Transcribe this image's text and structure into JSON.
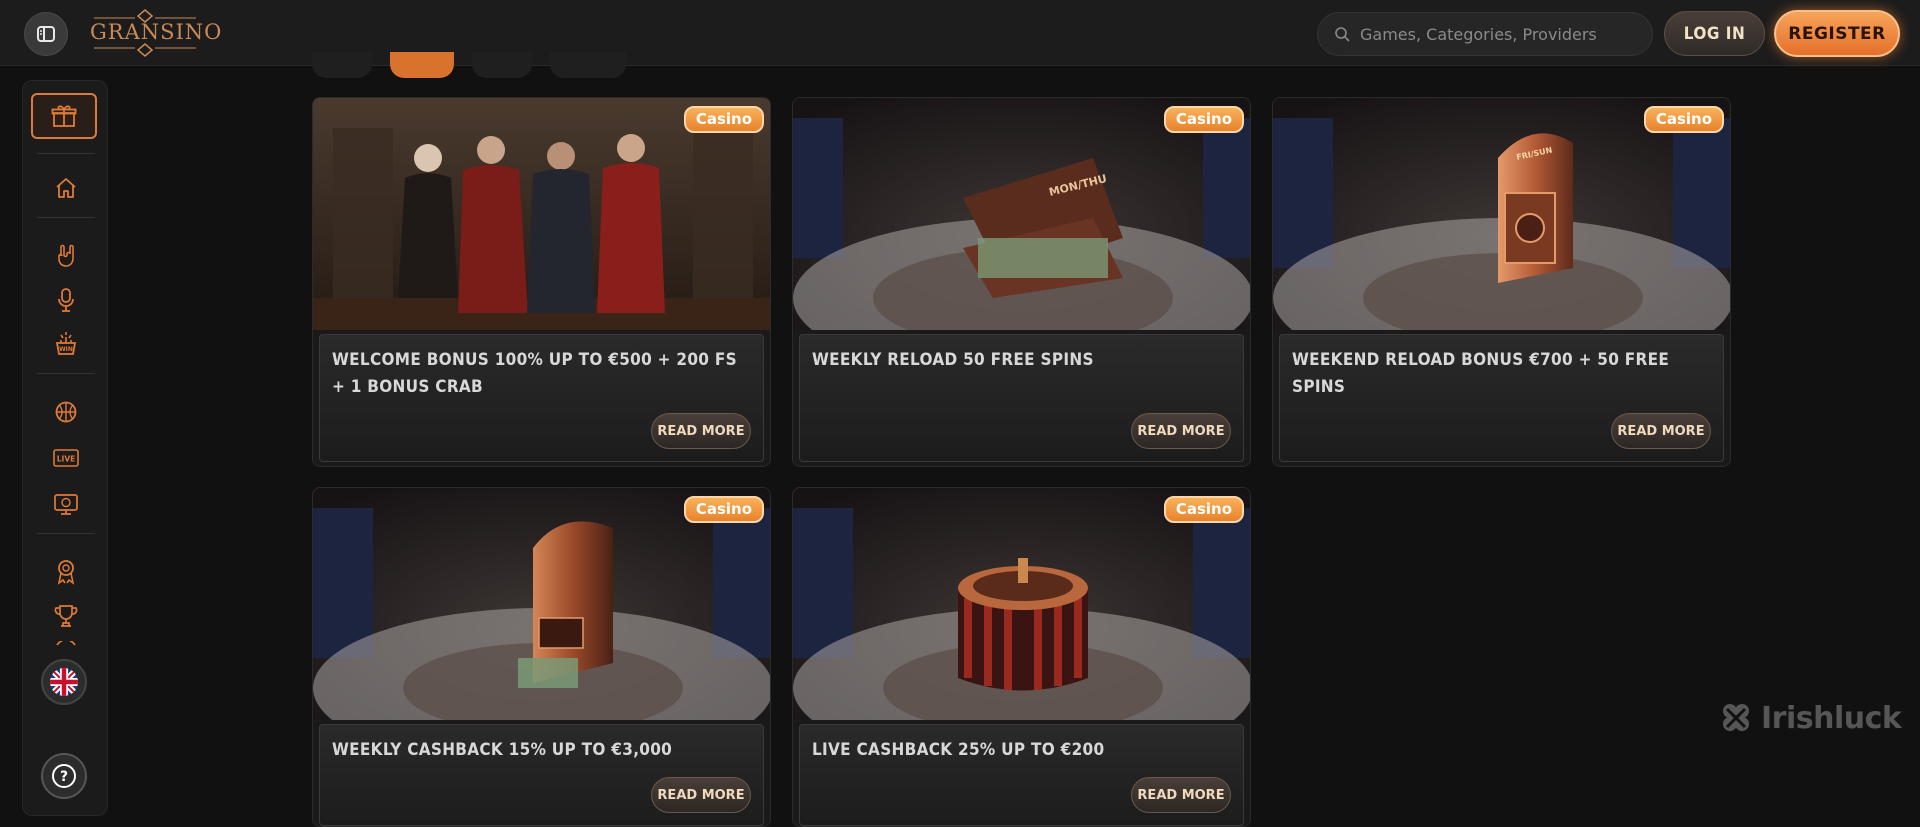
{
  "header": {
    "logo_text": "GRANSINO",
    "search_placeholder": "Games, Categories, Providers",
    "login_label": "LOG IN",
    "register_label": "REGISTER"
  },
  "sidebar": {
    "items": [
      {
        "icon": "gift-icon"
      },
      {
        "icon": "home-icon"
      },
      {
        "icon": "rock-hand-icon"
      },
      {
        "icon": "microphone-icon"
      },
      {
        "icon": "win-basket-icon"
      },
      {
        "icon": "basketball-icon"
      },
      {
        "icon": "live-icon"
      },
      {
        "icon": "virtual-sports-icon"
      },
      {
        "icon": "award-ribbon-icon"
      },
      {
        "icon": "trophy-icon"
      },
      {
        "icon": "flag-uk-icon"
      },
      {
        "icon": "help-icon"
      }
    ],
    "live_text": "LIVE",
    "help_glyph": "?"
  },
  "promotions": [
    {
      "badge": "Casino",
      "title": "WELCOME BONUS 100% UP TO €500 + 200 FS + 1 BONUS CRAB",
      "button": "READ MORE",
      "image_text": ""
    },
    {
      "badge": "Casino",
      "title": "WEEKLY RELOAD 50 FREE SPINS",
      "button": "READ MORE",
      "image_text": "MON/THU"
    },
    {
      "badge": "Casino",
      "title": "WEEKEND RELOAD BONUS €700 + 50 FREE SPINS",
      "button": "READ MORE",
      "image_text": "FRI/SUN"
    },
    {
      "badge": "Casino",
      "title": "WEEKLY CASHBACK 15% UP TO €3,000",
      "button": "READ MORE",
      "image_text": ""
    },
    {
      "badge": "Casino",
      "title": "LIVE CASHBACK 25% UP TO €200",
      "button": "READ MORE",
      "image_text": ""
    }
  ],
  "watermark": "Irishluck",
  "colors": {
    "accent": "#e5702a",
    "background": "#111111",
    "card": "#1a1a1a"
  }
}
